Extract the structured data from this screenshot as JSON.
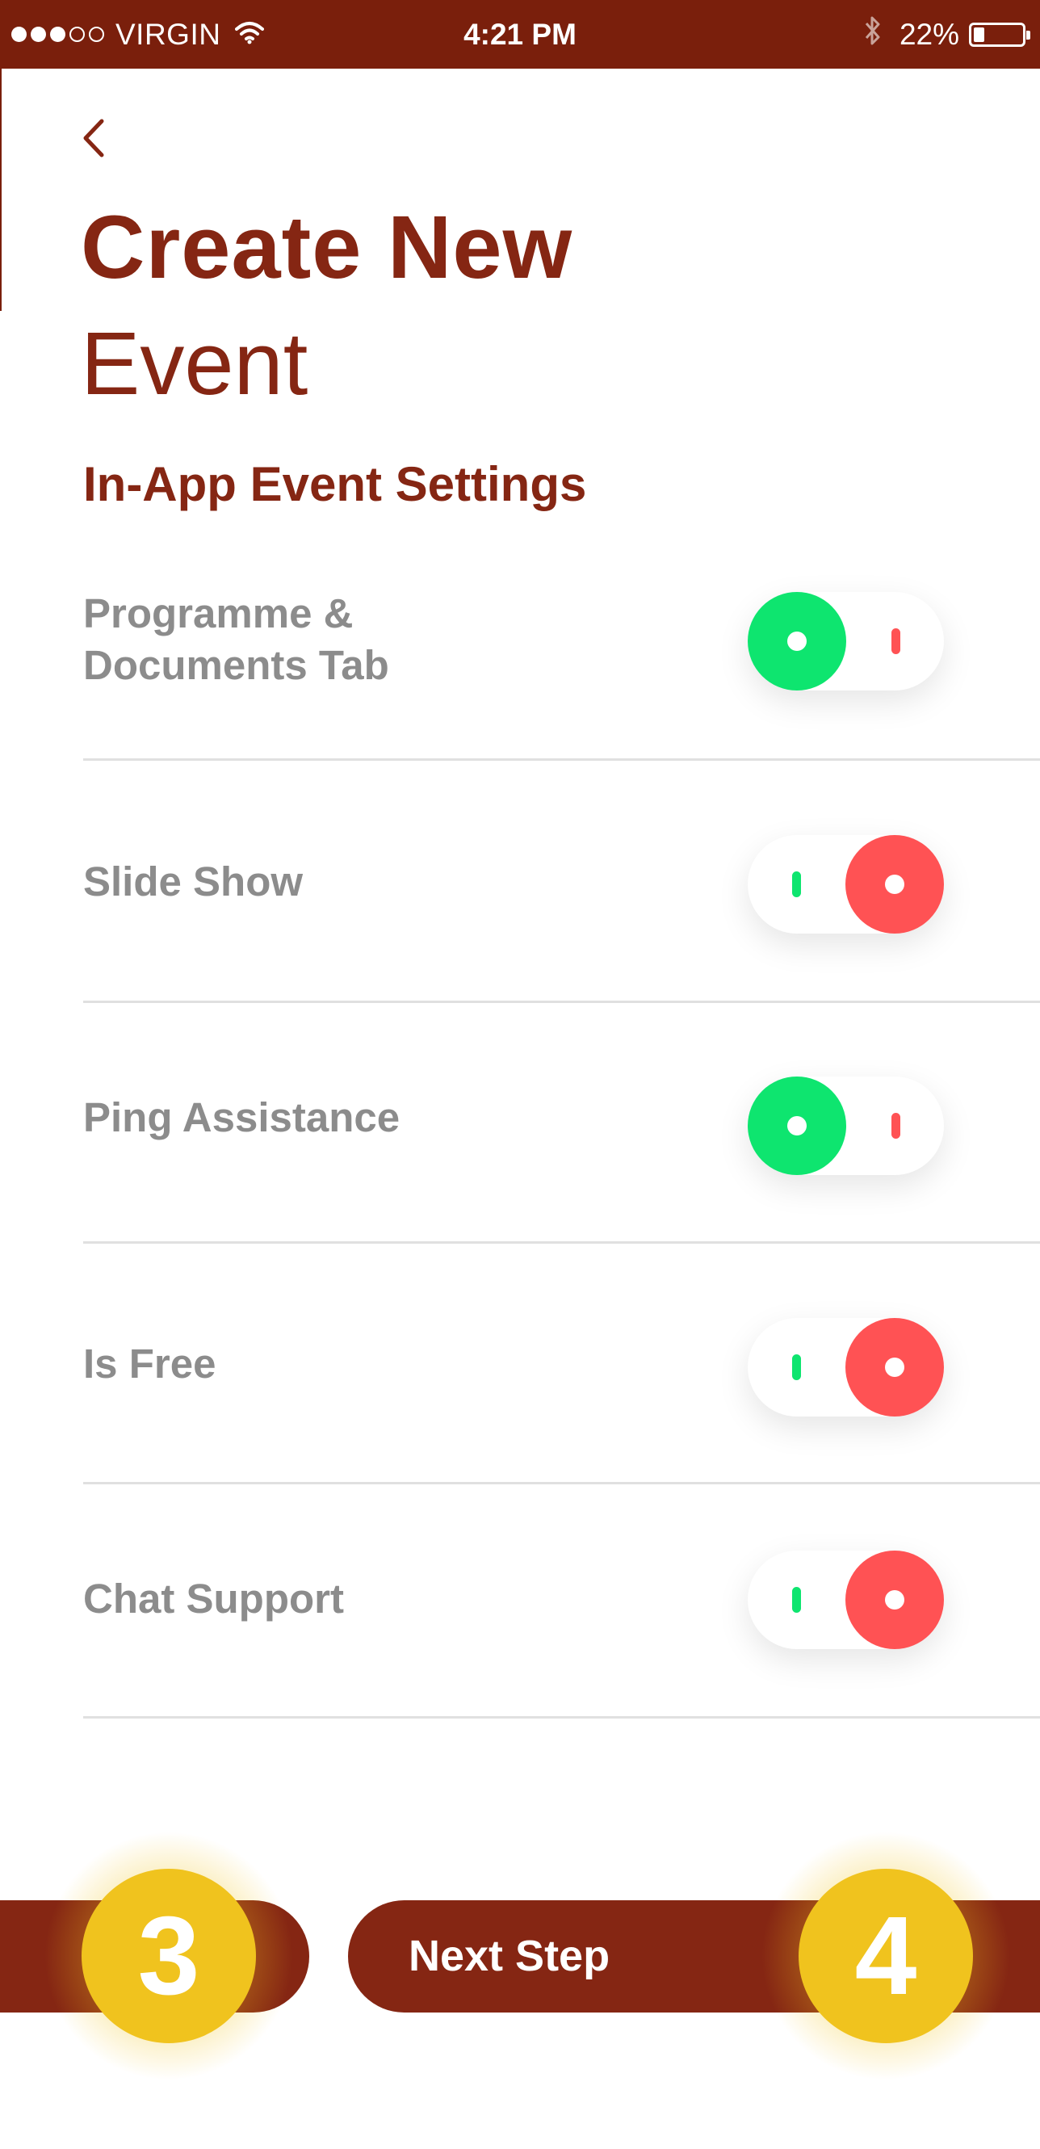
{
  "status_bar": {
    "carrier": "VIRGIN",
    "time": "4:21 PM",
    "battery": "22%",
    "signal_bars_filled": 3,
    "signal_bars_total": 5,
    "battery_level": 0.22
  },
  "header": {
    "back_icon": "chevron-left-icon",
    "title_line1": "Create New",
    "title_line2": "Event"
  },
  "section": {
    "title": "In-App Event Settings"
  },
  "settings": [
    {
      "label_line1": "Programme &",
      "label_line2": "Documents Tab",
      "enabled": true
    },
    {
      "label_line1": "Slide Show",
      "label_line2": "",
      "enabled": false
    },
    {
      "label_line1": "Ping Assistance",
      "label_line2": "",
      "enabled": true
    },
    {
      "label_line1": "Is Free",
      "label_line2": "",
      "enabled": false
    },
    {
      "label_line1": "Chat Support",
      "label_line2": "",
      "enabled": false
    }
  ],
  "footer": {
    "current_step": "3",
    "next_step_label": "Next Step",
    "next_step_number": "4"
  },
  "colors": {
    "brand": "#852613",
    "status_bar": "#7a1f0c",
    "toggle_on": "#0ee56f",
    "toggle_off": "#ff5254",
    "step_badge": "#f0c31e",
    "label_gray": "#8c8c8c"
  }
}
